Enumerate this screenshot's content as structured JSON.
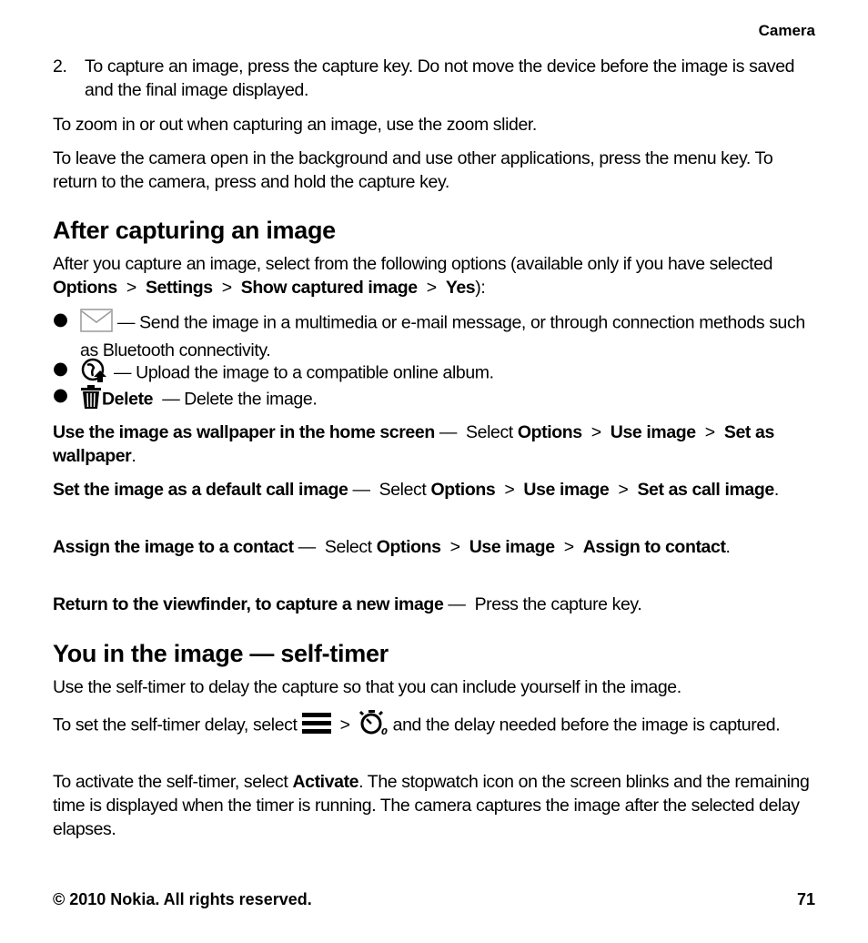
{
  "header": {
    "section": "Camera"
  },
  "step2": {
    "number": "2.",
    "text": "To capture an image, press the capture key. Do not move the device before the image is saved and the final image displayed."
  },
  "para_zoom": "To zoom in or out when capturing an image, use the zoom slider.",
  "para_background": "To leave the camera open in the background and use other applications, press the menu key. To return to the camera, press and hold the capture key.",
  "after": {
    "heading": "After capturing an image",
    "intro_a": "After you capture an image, select from the following options (available only if you have selected ",
    "path": [
      "Options",
      "Settings",
      "Show captured image",
      "Yes"
    ],
    "intro_b": "):",
    "sep": ">",
    "bullets": [
      {
        "icon": "envelope-icon",
        "text": "— Send the image in a multimedia or e-mail message, or through connection methods such as Bluetooth connectivity."
      },
      {
        "icon": "globe-upload-icon",
        "text": "— Upload the image to a compatible online album."
      },
      {
        "icon": "trash-icon",
        "label": "Delete",
        "text": "— Delete the image."
      }
    ],
    "actions": [
      {
        "title": "Use the image as wallpaper in the home screen",
        "dash": "—",
        "verb": "Select",
        "path": [
          "Options",
          "Use image",
          "Set as wallpaper"
        ],
        "end": "."
      },
      {
        "title": "Set the image as a default call image",
        "dash": "—",
        "verb": "Select",
        "path": [
          "Options",
          "Use image",
          "Set as call image"
        ],
        "end": "."
      },
      {
        "title": "Assign the image to a contact",
        "dash": "—",
        "verb": "Select",
        "path": [
          "Options",
          "Use image",
          "Assign to contact"
        ],
        "end": "."
      },
      {
        "title": "Return to the viewfinder, to capture a new image",
        "dash": "—",
        "verb": "Press the capture key.",
        "path": [],
        "end": ""
      }
    ]
  },
  "selftimer": {
    "heading": "You in the image — self-timer",
    "p1": "Use the self-timer to delay the capture so that you can include yourself in the image.",
    "p2_a": "To set the self-timer delay, select",
    "p2_b": "and the delay needed before the image is captured.",
    "p3_a": "To activate the self-timer, select ",
    "p3_bold": "Activate",
    "p3_b": ". The stopwatch icon on the screen blinks and the remaining time is displayed when the timer is running. The camera captures the image after the selected delay elapses."
  },
  "footer": {
    "copyright": "© 2010 Nokia. All rights reserved.",
    "page": "71"
  }
}
